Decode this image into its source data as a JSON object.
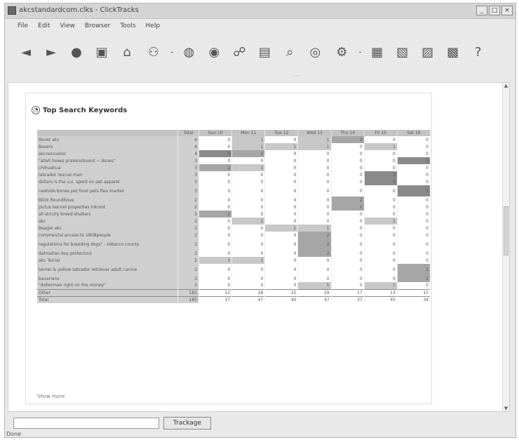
{
  "window": {
    "title": "akcstandardcom.clks - ClickTracks"
  },
  "menu": [
    "File",
    "Edit",
    "View",
    "Browser",
    "Tools",
    "Help"
  ],
  "toolbar_icons": [
    "back-icon",
    "forward-icon",
    "refresh-icon",
    "page-icon",
    "home-icon",
    "visitors-icon",
    "globe-icon",
    "globe2-icon",
    "people-icon",
    "report-icon",
    "search-icon",
    "coins-icon",
    "flow-icon",
    "table-icon",
    "pdf-icon",
    "export-icon",
    "print-icon",
    "help-icon"
  ],
  "panel": {
    "title": "Top Search Keywords",
    "columns": [
      "",
      "Total",
      "Sun 10",
      "Mon 11",
      "Tue 12",
      "Wed 13",
      "Thu 14",
      "Fri 15",
      "Sat 16"
    ],
    "rows": [
      {
        "keyword": "Rover akc",
        "total": "4",
        "days": [
          "0",
          "1",
          "0",
          "1",
          "2",
          "0",
          "0"
        ]
      },
      {
        "keyword": "Boxers",
        "total": "4",
        "days": [
          "0",
          "1",
          "1",
          "1",
          "0",
          "1",
          "0"
        ]
      },
      {
        "keyword": "akcrescueinc",
        "total": "4",
        "days": [
          "3",
          "2",
          "0",
          "0",
          "0",
          "0",
          "0"
        ]
      },
      {
        "keyword": "\"allah boxes prakenslsvent ~ dsnes\"",
        "total": "3",
        "days": [
          "0",
          "0",
          "0",
          "0",
          "0",
          "0",
          "3"
        ]
      },
      {
        "keyword": "chihuahua",
        "total": "3",
        "days": [
          "2",
          "1",
          "0",
          "0",
          "0",
          "0",
          "0"
        ]
      },
      {
        "keyword": "labrador rescue man",
        "total": "3",
        "days": [
          "0",
          "0",
          "0",
          "0",
          "0",
          "3",
          "0"
        ]
      },
      {
        "keyword": "dollars is the u.s. spent on pet apparel",
        "total": "3",
        "days": [
          "0",
          "0",
          "0",
          "0",
          "0",
          "3",
          "0"
        ]
      },
      {
        "keyword": "rawhide bones pet food pets flea market",
        "total": "3",
        "days": [
          "0",
          "0",
          "0",
          "0",
          "0",
          "0",
          "3"
        ]
      },
      {
        "keyword": "Blink Roundhove",
        "total": "2",
        "days": [
          "0",
          "0",
          "0",
          "0",
          "2",
          "0",
          "0"
        ]
      },
      {
        "keyword": "pictus kennel properties inkroot",
        "total": "2",
        "days": [
          "0",
          "0",
          "0",
          "0",
          "2",
          "0",
          "0"
        ]
      },
      {
        "keyword": "all strictly breed shelters",
        "total": "2",
        "days": [
          "2",
          "0",
          "0",
          "0",
          "0",
          "0",
          "0"
        ]
      },
      {
        "keyword": "akc",
        "total": "2",
        "days": [
          "0",
          "1",
          "0",
          "0",
          "0",
          "1",
          "0"
        ]
      },
      {
        "keyword": "Beagle akc",
        "total": "2",
        "days": [
          "0",
          "0",
          "1",
          "1",
          "0",
          "0",
          "0"
        ]
      },
      {
        "keyword": "commercial access to 180Bpeople",
        "total": "2",
        "days": [
          "0",
          "0",
          "0",
          "2",
          "0",
          "0",
          "0"
        ]
      },
      {
        "keyword": "regulations for breeding dogs\" - tobacco county",
        "total": "2",
        "days": [
          "0",
          "0",
          "0",
          "2",
          "0",
          "0",
          "0"
        ]
      },
      {
        "keyword": "dalmatian boy protectors",
        "total": "2",
        "days": [
          "0",
          "0",
          "0",
          "2",
          "0",
          "0",
          "0"
        ]
      },
      {
        "keyword": "akc Terrier",
        "total": "2",
        "days": [
          "1",
          "1",
          "0",
          "0",
          "0",
          "0",
          "0"
        ]
      },
      {
        "keyword": "terrier & yellow labrador retriever adult canine",
        "total": "2",
        "days": [
          "0",
          "0",
          "0",
          "0",
          "0",
          "0",
          "2"
        ]
      },
      {
        "keyword": "bavarians",
        "total": "2",
        "days": [
          "0",
          "0",
          "0",
          "0",
          "0",
          "0",
          "2"
        ]
      },
      {
        "keyword": "\"doberman right on the money\"",
        "total": "2",
        "days": [
          "0",
          "0",
          "0",
          "1",
          "0",
          "1",
          "0"
        ]
      }
    ],
    "other": {
      "label": "Other",
      "total": "181",
      "days": [
        "12",
        "28",
        "25",
        "29",
        "17",
        "13",
        "15"
      ]
    },
    "total": {
      "label": "Total",
      "total": "185",
      "days": [
        "37",
        "47",
        "40",
        "47",
        "37",
        "45",
        "34"
      ]
    },
    "show_more": "Show more"
  },
  "bottom": {
    "track_button": "Trackage",
    "input_value": ""
  },
  "status": {
    "text": "Done"
  }
}
